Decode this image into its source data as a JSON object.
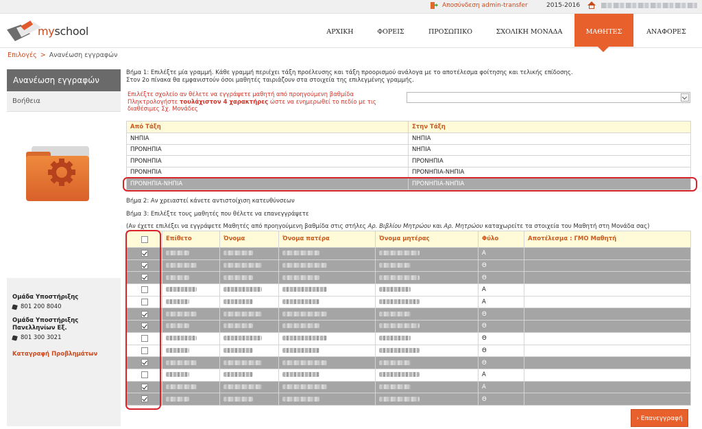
{
  "topbar": {
    "logout_label": "Αποσύνδεση admin-transfer",
    "school_year": "2015-2016"
  },
  "brand": {
    "prefix": "my",
    "suffix": "school"
  },
  "nav": {
    "items": [
      {
        "label": "ΑΡΧΙΚΗ"
      },
      {
        "label": "ΦΟΡΕΙΣ"
      },
      {
        "label": "ΠΡΟΣΩΠΙΚΟ"
      },
      {
        "label": "ΣΧΟΛΙΚΗ ΜΟΝΑΔΑ"
      },
      {
        "label": "ΜΑΘΗΤΕΣ"
      },
      {
        "label": "ΑΝΑΦΟΡΕΣ"
      }
    ],
    "active": "ΜΑΘΗΤΕΣ"
  },
  "breadcrumb": {
    "root": "Επιλογές",
    "separator": ">",
    "current": "Ανανέωση εγγραφών"
  },
  "sidebar": {
    "title": "Ανανέωση εγγραφών",
    "help": "Βοήθεια",
    "support_label": "Ομάδα Υποστήριξης",
    "support_phone": "801 200 8040",
    "exams_support_label": "Ομάδα Υποστήριξης Πανελληνίων Εξ.",
    "exams_support_phone": "801 300 3021",
    "report_problems": "Καταγραφή Προβλημάτων"
  },
  "main": {
    "step1_line1": "Βήμα 1: Επιλέξτε μία γραμμή. Κάθε γραμμή περιέχει τάξη προέλευσης και τάξη προορισμού ανάλογα με το αποτέλεσμα φοίτησης και τελικής επίδοσης.",
    "step1_line2": "Στον 2ο πίνακα θα εμφανιστούν όσοι μαθητές ταιριάζουν στα στοιχεία της επιλεγμένης γραμμής.",
    "school_hint_1": "Επιλέξτε σχολείο αν θέλετε να εγγράψετε μαθητή από προηγούμενη βαθμίδα",
    "school_hint_2a": "Πληκτρολογήστε ",
    "school_hint_2b": "τουλάχιστον 4 χαρακτήρες",
    "school_hint_2c": " ώστε να ενημερωθεί το πεδίο με τις διαθέσιμες Σχ. Μονάδες",
    "step2": "Βήμα 2: Αν χρειαστεί κάνετε αντιστοίχιση κατευθύνσεων",
    "step3": "Βήμα 3: Επιλέξτε τους μαθητές που θέλετε να επανεγγράψετε",
    "note_a": "(Αν έχετε επιλέξει να εγγράψετε Μαθητές από προηγούμενη βαθμίδα στις στήλες ",
    "note_b": "Αρ. Βιβλίου Μητρώου",
    "note_c": " και ",
    "note_d": "Αρ. Μητρώου",
    "note_e": " καταχωρείτε τα στοιχεία του Μαθητή στη Μονάδα σας)",
    "reenroll_button": "› Επανεγγραφή"
  },
  "grades_table": {
    "headers": {
      "from": "Από Τάξη",
      "to": "Στην Τάξη"
    },
    "rows": [
      {
        "from": "ΝΗΠΙΑ",
        "to": "ΝΗΠΙΑ",
        "selected": false
      },
      {
        "from": "ΠΡΟΝΗΠΙΑ",
        "to": "ΝΗΠΙΑ",
        "selected": false
      },
      {
        "from": "ΠΡΟΝΗΠΙΑ",
        "to": "ΠΡΟΝΗΠΙΑ",
        "selected": false
      },
      {
        "from": "ΠΡΟΝΗΠΙΑ",
        "to": "ΠΡΟΝΗΠΙΑ-ΝΗΠΙΑ",
        "selected": false
      },
      {
        "from": "ΠΡΟΝΗΠΙΑ-ΝΗΠΙΑ",
        "to": "ΠΡΟΝΗΠΙΑ-ΝΗΠΙΑ",
        "selected": true
      }
    ]
  },
  "students_table": {
    "headers": {
      "surname": "Επίθετο",
      "name": "Όνομα",
      "father": "Όνομα πατέρα",
      "mother": "Όνομα μητέρας",
      "gender": "Φύλο",
      "result": "Αποτέλεσμα : ΓΜΟ Μαθητή"
    },
    "rows": [
      {
        "checked": true,
        "gender": "Α"
      },
      {
        "checked": true,
        "gender": "Θ"
      },
      {
        "checked": true,
        "gender": "Θ"
      },
      {
        "checked": false,
        "gender": "Α"
      },
      {
        "checked": false,
        "gender": "Α"
      },
      {
        "checked": true,
        "gender": "Θ"
      },
      {
        "checked": true,
        "gender": "Θ"
      },
      {
        "checked": false,
        "gender": "Θ"
      },
      {
        "checked": false,
        "gender": "Θ"
      },
      {
        "checked": true,
        "gender": "Θ"
      },
      {
        "checked": false,
        "gender": "Α"
      },
      {
        "checked": true,
        "gender": "Α"
      },
      {
        "checked": true,
        "gender": "Θ"
      }
    ]
  },
  "colors": {
    "accent": "#e8602c",
    "link": "#c84a1f",
    "highlight": "#d7242a",
    "selected_row": "#a5a5a5",
    "header_row": "#fffbd9"
  },
  "icons": [
    "logout-icon",
    "home-icon",
    "brand-logo",
    "settings-folder-icon",
    "phone-icon",
    "checkbox"
  ]
}
